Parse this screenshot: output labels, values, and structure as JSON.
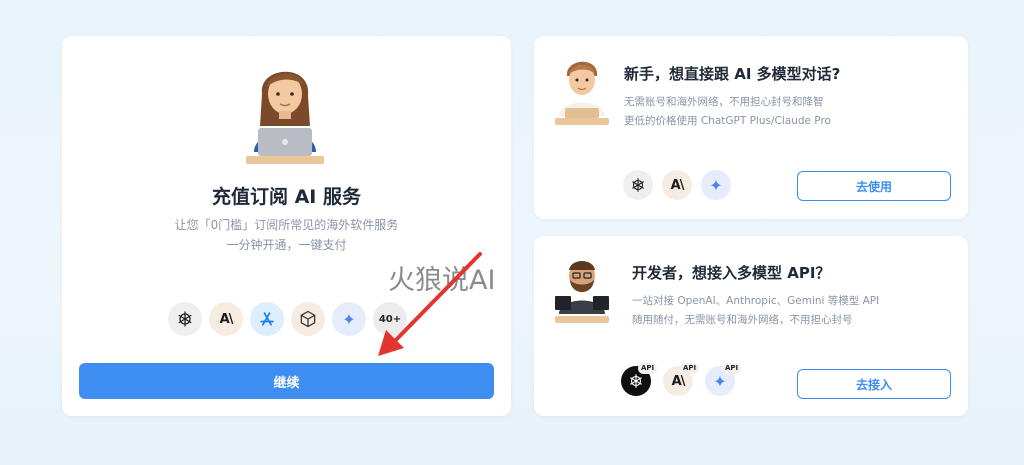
{
  "left_card": {
    "title": "充值订阅 AI 服务",
    "subtitle_line1": "让您「0门槛」订阅所常见的海外软件服务",
    "subtitle_line2": "一分钟开通，一键支付",
    "services": [
      {
        "icon": "openai-icon",
        "label": ""
      },
      {
        "icon": "anthropic-icon",
        "label": "A\\"
      },
      {
        "icon": "app-store-icon",
        "label": ""
      },
      {
        "icon": "box-3d-icon",
        "label": ""
      },
      {
        "icon": "gemini-sparkle-icon",
        "label": "✦"
      },
      {
        "icon": "more-count",
        "label": "40+"
      }
    ],
    "continue_label": "继续"
  },
  "right_top_card": {
    "title": "新手，想直接跟 AI 多模型对话?",
    "desc_line1": "无需账号和海外网络，不用担心封号和降智",
    "desc_line2": "更低的价格使用 ChatGPT Plus/Claude Pro",
    "icons": [
      "openai-icon",
      "anthropic-icon",
      "gemini-sparkle-icon"
    ],
    "anthropic_label": "A\\",
    "gemini_label": "✦",
    "button_label": "去使用"
  },
  "right_bottom_card": {
    "title": "开发者，想接入多模型 API？",
    "desc_line1": "一站对接 OpenAI、Anthropic、Gemini 等模型 API",
    "desc_line2": "随用随付，无需账号和海外网络，不用担心封号",
    "api_badge": "API",
    "anthropic_label": "A\\",
    "gemini_label": "✦",
    "button_label": "去接入"
  },
  "watermark": "火狼说AI",
  "colors": {
    "primary": "#3d8ef0",
    "background": "#eaf3fb",
    "arrow": "#e3342f",
    "muted_text": "#8a94a6"
  }
}
